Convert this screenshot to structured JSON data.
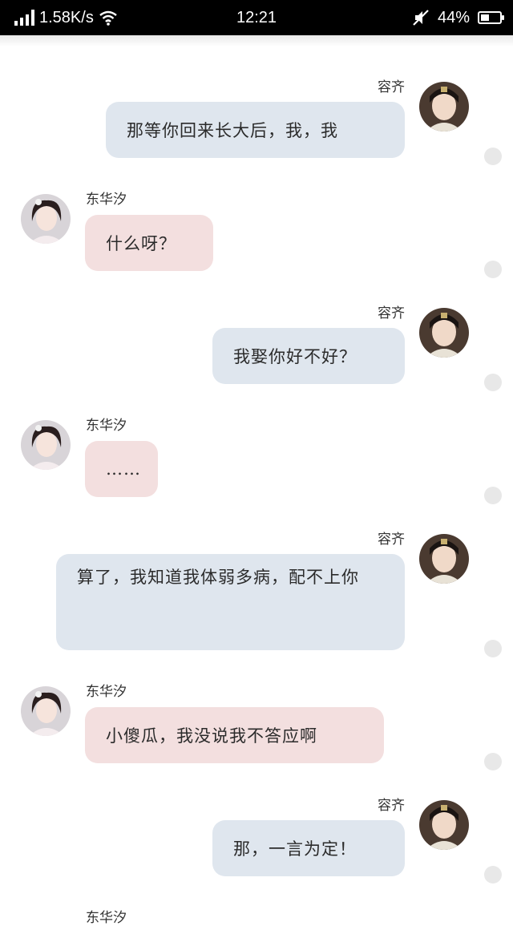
{
  "status_bar": {
    "speed": "1.58K/s",
    "time": "12:21",
    "battery": "44%",
    "battery_level": 0.44
  },
  "people": {
    "male": "容齐",
    "female": "东华汐"
  },
  "messages": [
    {
      "side": "right",
      "name": "容齐",
      "text": "那等你回来长大后，我，我"
    },
    {
      "side": "left",
      "name": "东华汐",
      "text": "什么呀？"
    },
    {
      "side": "right",
      "name": "容齐",
      "text": "我娶你好不好？"
    },
    {
      "side": "left",
      "name": "东华汐",
      "text": "……"
    },
    {
      "side": "right",
      "name": "容齐",
      "text": "算了，我知道我体弱多病，配不上你"
    },
    {
      "side": "left",
      "name": "东华汐",
      "text": "小傻瓜，我没说我不答应啊"
    },
    {
      "side": "right",
      "name": "容齐",
      "text": "那，一言为定！"
    },
    {
      "side": "left",
      "name": "东华汐",
      "text": ""
    }
  ],
  "icons": {
    "signal": "signal-icon",
    "wifi": "wifi-icon",
    "mute": "mute-icon",
    "battery": "battery-icon",
    "avatar_male": "male-avatar",
    "avatar_female": "female-avatar"
  },
  "colors": {
    "bubble_right": "#dfe6ee",
    "bubble_left": "#f3dfdf",
    "status_bar": "#000000"
  }
}
